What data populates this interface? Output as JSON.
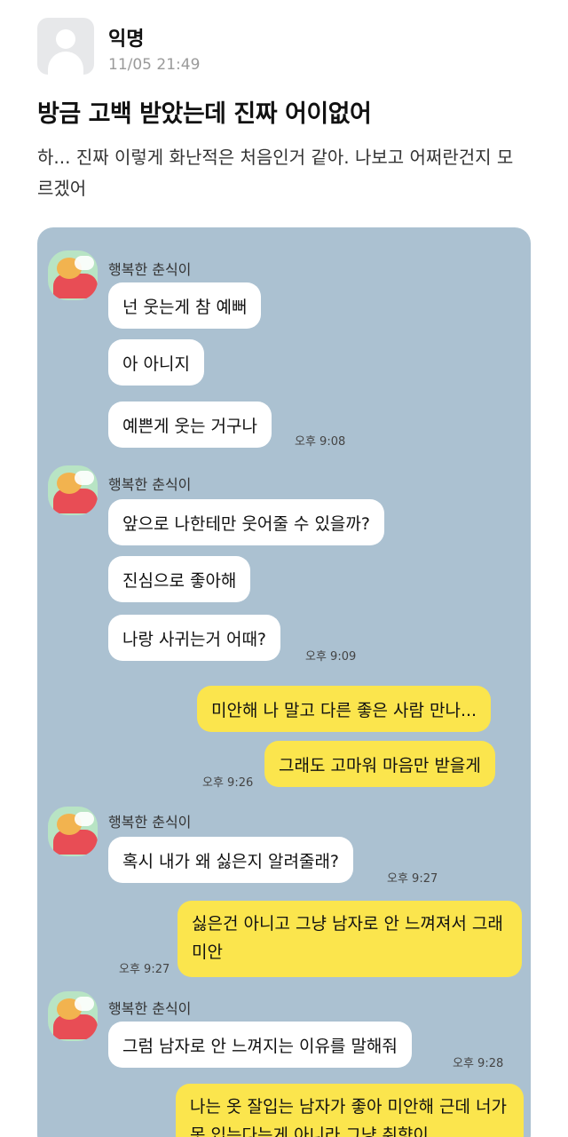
{
  "post": {
    "author": "익명",
    "time": "11/05 21:49",
    "title": "방금 고백 받았는데 진짜 어이없어",
    "body": "하... 진짜 이렇게 화난적은 처음인거 같아. 나보고 어쩌란건지 모르겠어"
  },
  "chat": {
    "sender": "행복한 춘식이",
    "messages": [
      "넌 웃는게 참 예뻐",
      "아 아니지",
      "예쁜게 웃는 거구나",
      "앞으로 나한테만 웃어줄 수 있을까?",
      "진심으로 좋아해",
      "나랑 사귀는거 어때?",
      "미안해 나 말고 다른 좋은 사람 만나...",
      "그래도 고마워 마음만 받을게",
      "혹시 내가 왜 싫은지 알려줄래?",
      "싫은건 아니고 그냥 남자로 안 느껴져서 그래 미안",
      "그럼 남자로 안 느껴지는 이유를 말해줘",
      "나는 옷 잘입는 남자가 좋아 미안해 근데 너가 못 입는다는게 아니라 그냥 취향이"
    ],
    "times": [
      "오후 9:08",
      "오후 9:09",
      "오후 9:26",
      "오후 9:27",
      "오후 9:27",
      "오후 9:28"
    ]
  }
}
